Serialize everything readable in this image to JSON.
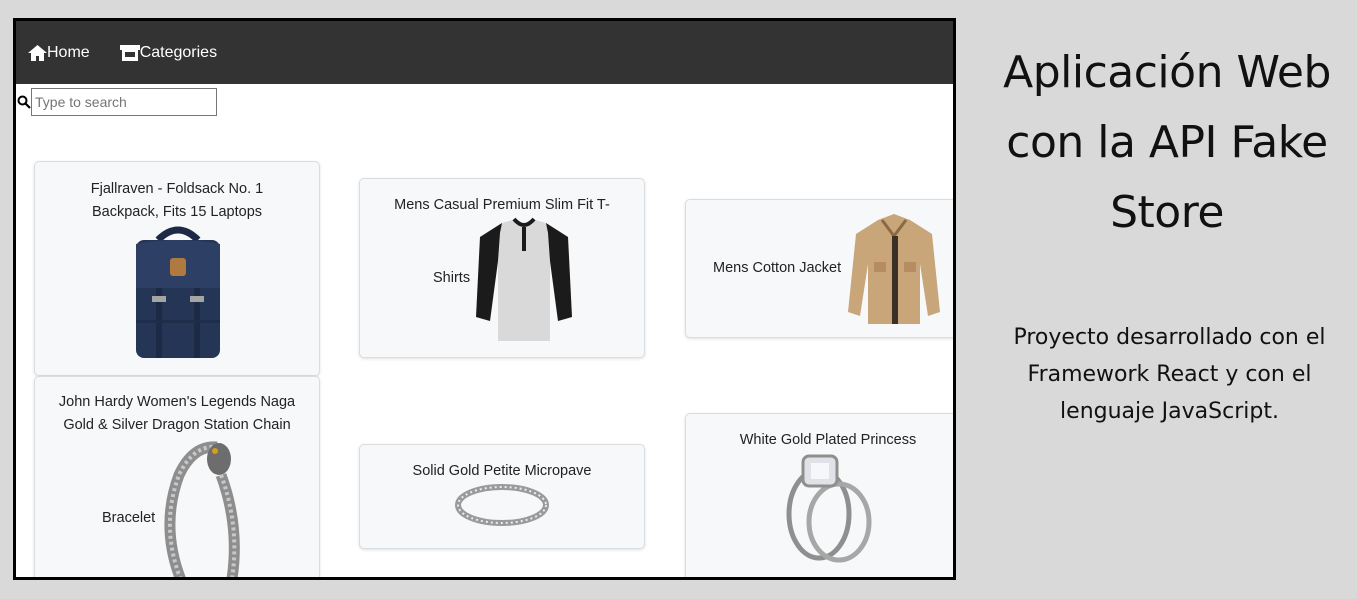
{
  "nav": {
    "home_label": "Home",
    "categories_label": "Categories"
  },
  "search": {
    "placeholder": "Type to search",
    "value": ""
  },
  "products": [
    {
      "title": "Fjallraven - Foldsack No. 1 Backpack, Fits 15 Laptops",
      "image": "backpack"
    },
    {
      "title": "Mens Casual Premium Slim Fit T-Shirts",
      "image": "t-shirt"
    },
    {
      "title": "Mens Cotton Jacket",
      "image": "jacket"
    },
    {
      "title": "John Hardy Women's Legends Naga Gold & Silver Dragon Station Chain Bracelet",
      "image": "bracelet"
    },
    {
      "title": "Solid Gold Petite Micropave",
      "image": "ring"
    },
    {
      "title": "White Gold Plated Princess",
      "image": "ring-set"
    }
  ],
  "card_text": {
    "p0_line1": "Fjallraven - Foldsack No. 1",
    "p0_line2": "Backpack, Fits 15 Laptops",
    "p1_line1": "Mens Casual Premium Slim Fit T-",
    "p1_line2": "Shirts",
    "p2_line1": "Mens Cotton Jacket",
    "p3_line1": "John Hardy Women's Legends Naga",
    "p3_line2": "Gold & Silver Dragon Station Chain",
    "p3_line3": "Bracelet",
    "p4_line1": "Solid Gold Petite Micropave",
    "p5_line1": "White Gold Plated Princess"
  },
  "side": {
    "title_line1": "Aplicación Web",
    "title_line2": "con la API Fake",
    "title_line3": "Store",
    "desc_line1": "Proyecto desarrollado con el",
    "desc_line2": "Framework React y con el",
    "desc_line3": "lenguaje JavaScript."
  },
  "colors": {
    "navbar": "#333333",
    "page_background": "#d9d9d9",
    "card_background": "#f7f8f9"
  }
}
